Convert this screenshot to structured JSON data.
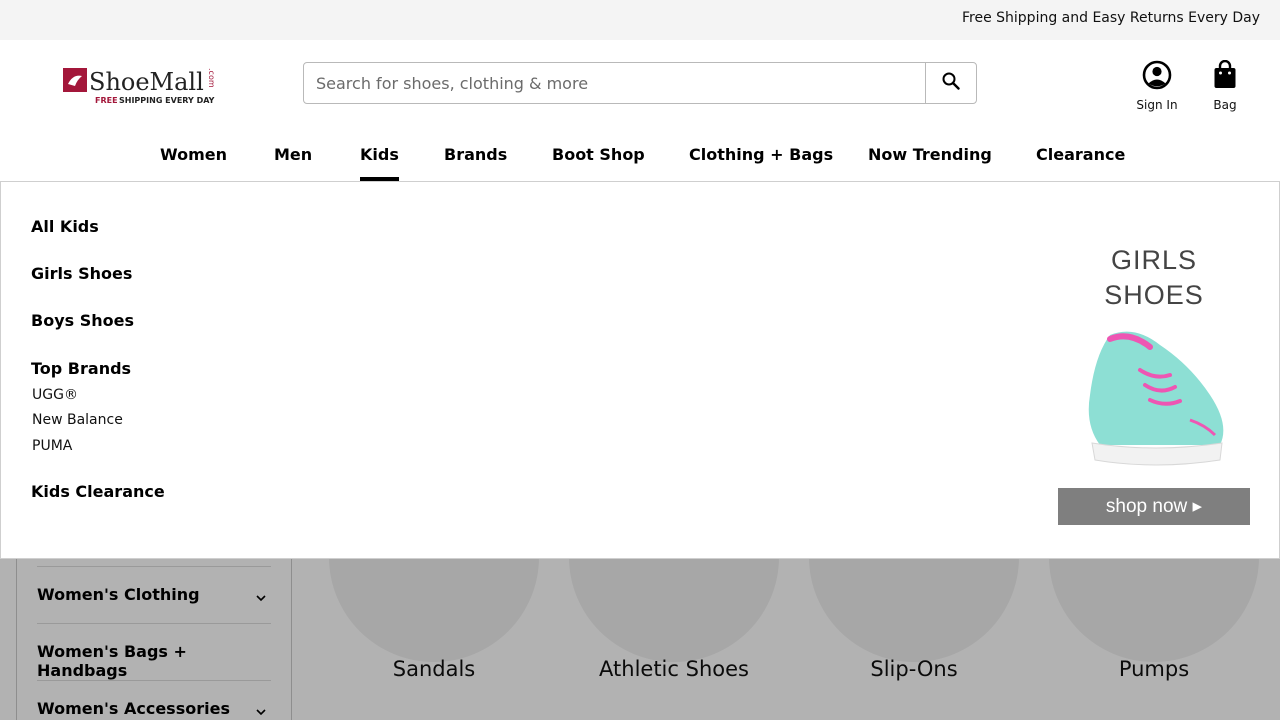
{
  "topbar": {
    "message": "Free Shipping and Easy Returns Every Day"
  },
  "logo": {
    "name": "ShoeMall",
    "suffix": ".com",
    "tagline_free": "FREE",
    "tagline_rest": "SHIPPING EVERY DAY",
    "brand_color": "#a3173a"
  },
  "search": {
    "placeholder": "Search for shoes, clothing & more",
    "value": "",
    "icon": "search-icon"
  },
  "utility": {
    "account_label": "Sign In",
    "account_icon": "user-circle-icon",
    "bag_label": "Bag",
    "bag_icon": "bag-icon"
  },
  "nav": {
    "active": "Kids",
    "items": [
      "Women",
      "Men",
      "Kids",
      "Brands",
      "Boot Shop",
      "Clothing + Bags",
      "Now Trending",
      "Clearance"
    ]
  },
  "megamenu": {
    "all": "All Kids",
    "girls": "Girls Shoes",
    "boys": "Boys Shoes",
    "top_brands": "Top Brands",
    "brands": [
      "UGG®",
      "New Balance",
      "PUMA"
    ],
    "clearance": "Kids Clearance",
    "promo": {
      "title_line1": "GIRLS",
      "title_line2": "SHOES",
      "button": "shop now ▸"
    }
  },
  "sidebar": {
    "items": [
      {
        "label": "Women's Clothing",
        "expandable": true
      },
      {
        "label": "Women's Bags + Handbags",
        "expandable": false
      },
      {
        "label": "Women's Accessories",
        "expandable": true
      }
    ]
  },
  "categories": [
    "Sandals",
    "Athletic Shoes",
    "Slip-Ons",
    "Pumps"
  ]
}
